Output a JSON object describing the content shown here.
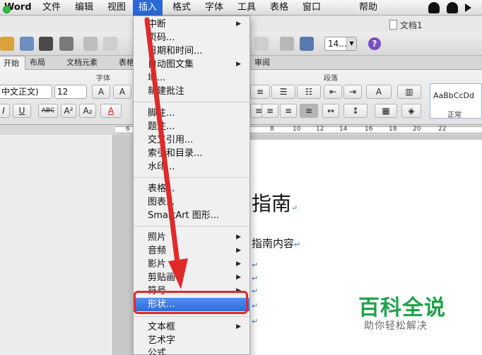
{
  "menubar": {
    "app": "Word",
    "items": [
      "文件",
      "编辑",
      "视图",
      "插入",
      "格式",
      "字体",
      "工具",
      "表格",
      "窗口",
      "帮助"
    ],
    "active": "插入"
  },
  "window": {
    "doc_title": "文档1"
  },
  "toolbar": {
    "zoom": "14..."
  },
  "ribbon_tabs": [
    "开始",
    "布局",
    "文档元素",
    "表格",
    "审阅"
  ],
  "ribbon": {
    "group_font": "字体",
    "group_paragraph": "段落",
    "font_name": "中文正文)",
    "font_size": "12",
    "style_sample": "AaBbCcDd",
    "style_normal": "正常",
    "buttons": {
      "grow": "A",
      "shrink": "A",
      "bold": "I",
      "underline": "U",
      "strike": "ABC",
      "superscript": "A²",
      "subscript": "A₂",
      "fontcolor": "A"
    }
  },
  "ruler": {
    "numbers": [
      "6",
      "8",
      "10",
      "12",
      "14",
      "16",
      "18",
      "20",
      "22"
    ]
  },
  "document": {
    "heading": "指南",
    "body": "指南内容"
  },
  "insert_menu": {
    "items": [
      {
        "label": "中断",
        "submenu": true
      },
      {
        "label": "页码...",
        "submenu": false
      },
      {
        "label": "日期和时间...",
        "submenu": false
      },
      {
        "label": "自动图文集",
        "submenu": true
      },
      {
        "label": "域...",
        "submenu": false
      },
      {
        "label": "新建批注",
        "submenu": false
      },
      {
        "label": "脚注...",
        "submenu": false
      },
      {
        "label": "题注...",
        "submenu": false
      },
      {
        "label": "交叉引用...",
        "submenu": false
      },
      {
        "label": "索引和目录...",
        "submenu": false
      },
      {
        "label": "水印...",
        "submenu": false
      },
      {
        "label": "表格...",
        "submenu": false
      },
      {
        "label": "图表...",
        "submenu": false
      },
      {
        "label": "SmartArt 图形...",
        "submenu": false
      },
      {
        "label": "照片",
        "submenu": true
      },
      {
        "label": "音频",
        "submenu": true
      },
      {
        "label": "影片",
        "submenu": true
      },
      {
        "label": "剪贴画",
        "submenu": true
      },
      {
        "label": "符号",
        "submenu": true
      },
      {
        "label": "形状...",
        "submenu": false
      },
      {
        "label": "文本框",
        "submenu": true
      },
      {
        "label": "艺术字",
        "submenu": false
      },
      {
        "label": "公式",
        "submenu": false
      }
    ],
    "highlighted": "形状...",
    "submenu_glyph": "▶"
  },
  "watermark": {
    "title": "百科全说",
    "subtitle": "助你轻松解决"
  },
  "colors": {
    "menu_highlight": "#2b69d6",
    "annotation": "#e02a2a",
    "watermark": "#1ea24a"
  }
}
